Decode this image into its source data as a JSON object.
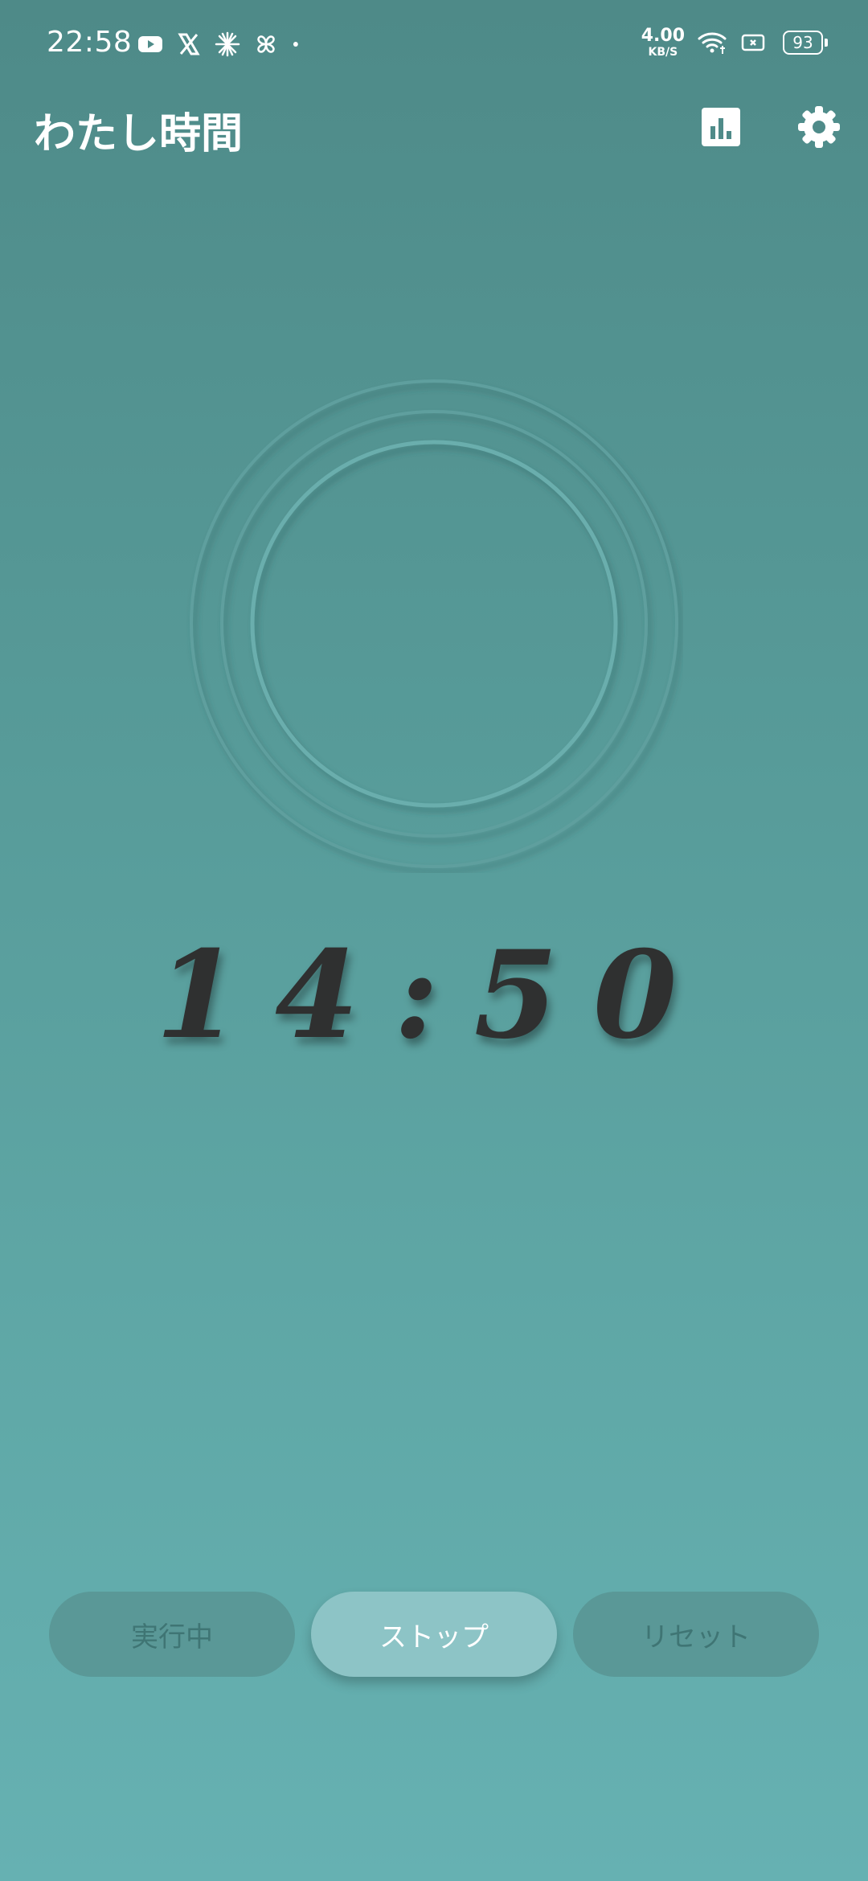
{
  "status_bar": {
    "time": "22:58",
    "net_speed_value": "4.00",
    "net_speed_unit": "KB/S",
    "battery": "93",
    "icons": [
      "youtube-icon",
      "x-icon",
      "asterisk-icon",
      "pinwheel-icon",
      "dot-icon",
      "wifi-icon",
      "screen-record-icon",
      "battery-icon"
    ]
  },
  "app_bar": {
    "title": "わたし時間",
    "actions": [
      "stats-icon",
      "settings-icon"
    ]
  },
  "timer": {
    "display": "14:50"
  },
  "controls": {
    "running_label": "実行中",
    "stop_label": "ストップ",
    "reset_label": "リセット"
  },
  "colors": {
    "background_top": "#4e8a88",
    "background_bottom": "#66b1b2",
    "timer_text": "#2f3030",
    "active_button": "#8dc4c6",
    "inactive_button": "#5a9897"
  }
}
